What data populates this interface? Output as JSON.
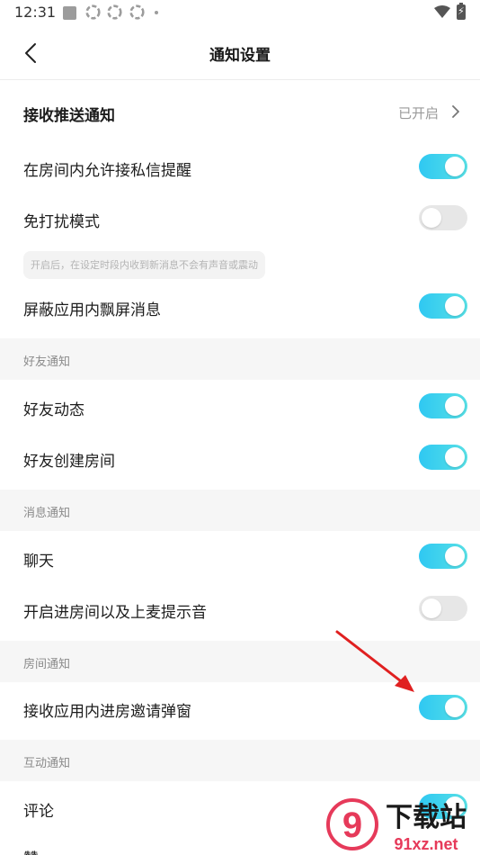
{
  "status_bar": {
    "time": "12:31",
    "icons": [
      "gallery-icon",
      "app-icon",
      "app-icon",
      "app-icon",
      "dot-icon",
      "wifi-icon",
      "battery-icon"
    ]
  },
  "header": {
    "title": "通知设置",
    "back_icon": "chevron-left-icon"
  },
  "settings": {
    "push": {
      "label": "接收推送通知",
      "value": "已开启"
    },
    "private_msg": {
      "label": "在房间内允许接私信提醒",
      "enabled": true
    },
    "dnd": {
      "label": "免打扰模式",
      "enabled": false,
      "hint": "开启后，在设定时段内收到新消息不会有声音或震动"
    },
    "block_float": {
      "label": "屏蔽应用内飘屏消息",
      "enabled": true
    }
  },
  "sections": {
    "friends": {
      "title": "好友通知",
      "items": [
        {
          "label": "好友动态",
          "enabled": true
        },
        {
          "label": "好友创建房间",
          "enabled": true
        }
      ]
    },
    "messages": {
      "title": "消息通知",
      "items": [
        {
          "label": "聊天",
          "enabled": true
        },
        {
          "label": "开启进房间以及上麦提示音",
          "enabled": false
        }
      ]
    },
    "room": {
      "title": "房间通知",
      "items": [
        {
          "label": "接收应用内进房邀请弹窗",
          "enabled": true
        }
      ]
    },
    "interaction": {
      "title": "互动通知",
      "items": [
        {
          "label": "评论",
          "enabled": true
        },
        {
          "label": "赞",
          "enabled": true
        }
      ]
    }
  },
  "overlay": {
    "arrow_color": "#e02020",
    "watermark_text": "下载站",
    "watermark_url": "91xz.net",
    "watermark_logo": "9"
  },
  "colors": {
    "toggle_on": "#2fc8f2",
    "toggle_off": "#e7e7e7",
    "section_bg": "#f6f6f6"
  }
}
